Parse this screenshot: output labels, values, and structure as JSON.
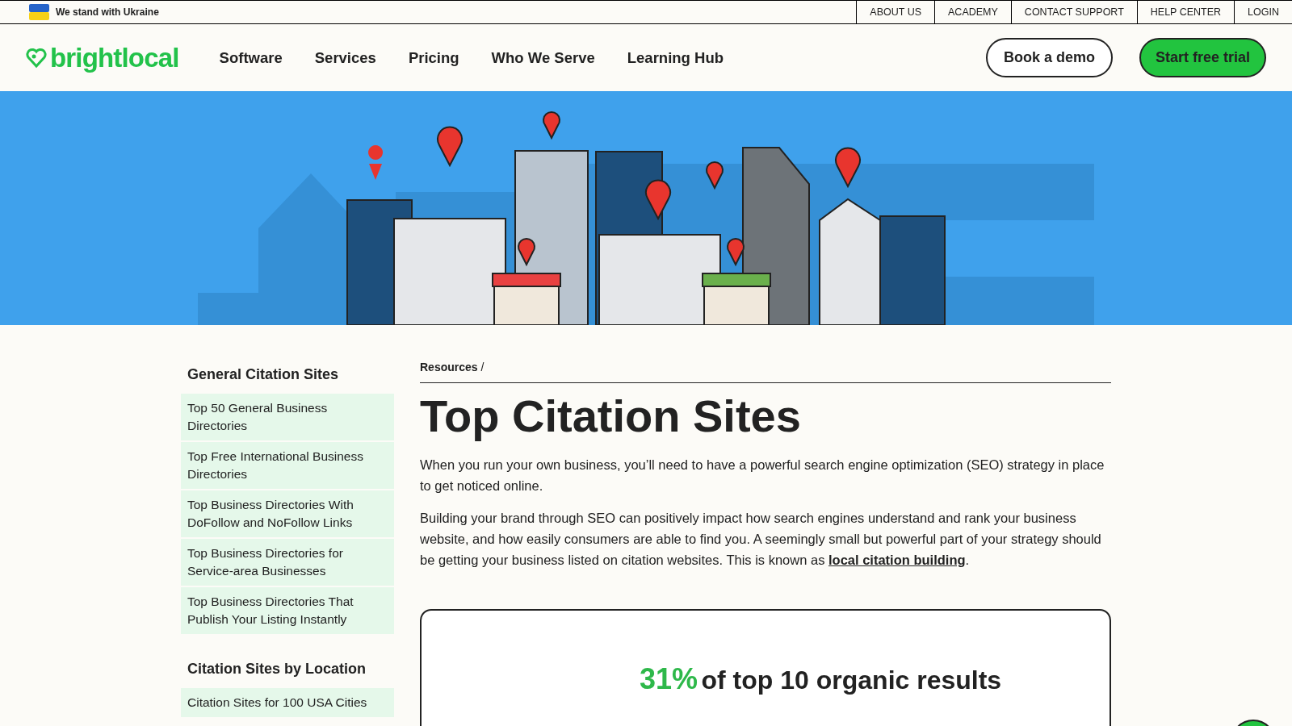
{
  "top_bar": {
    "ukraine_text": "We stand with Ukraine",
    "links": [
      "ABOUT US",
      "ACADEMY",
      "CONTACT SUPPORT",
      "HELP CENTER",
      "LOGIN"
    ]
  },
  "header": {
    "logo": "brightlocal",
    "nav": [
      "Software",
      "Services",
      "Pricing",
      "Who We Serve",
      "Learning Hub"
    ],
    "demo_button": "Book a demo",
    "trial_button": "Start free trial"
  },
  "sidebar": [
    {
      "heading": "General Citation Sites",
      "items": [
        "Top 50 General Business Directories",
        "Top Free International Business Directories",
        "Top Business Directories With DoFollow and NoFollow Links",
        "Top Business Directories for Service-area Businesses",
        "Top Business Directories That Publish Your Listing Instantly"
      ]
    },
    {
      "heading": "Citation Sites by Location",
      "items": [
        "Citation Sites for 100 USA Cities"
      ]
    }
  ],
  "breadcrumb": [
    "Resources",
    "/"
  ],
  "title": "Top Citation Sites",
  "paragraphs": [
    "When you run your own business, you’ll need to have a powerful search engine optimization (SEO) strategy in place to get noticed online.",
    "Building your brand through SEO can positively impact how search engines understand and rank your business website, and how easily consumers are able to find you. A seemingly small but powerful part of your strategy should be getting your business listed on citation websites. This is known as "
  ],
  "paragraph_link": "local citation building",
  "paragraph_end": ".",
  "stat_card": {
    "value": "31%",
    "text": "of top 10 organic results"
  }
}
